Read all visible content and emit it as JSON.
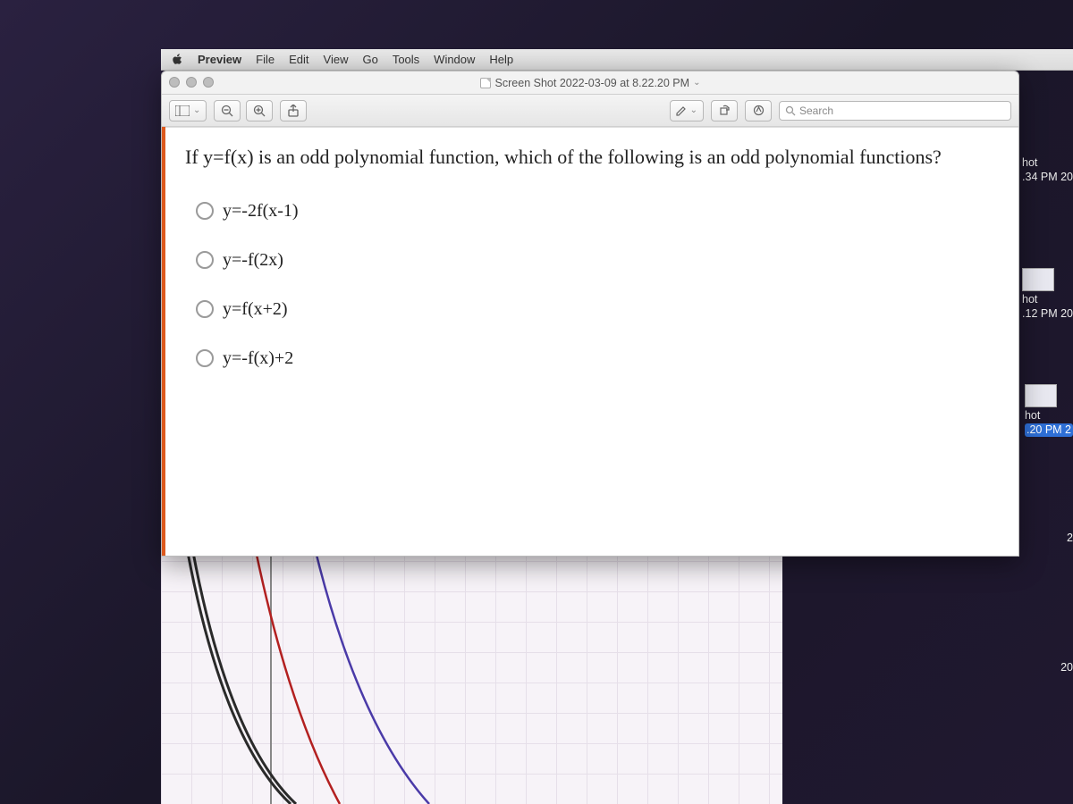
{
  "menubar": {
    "app": "Preview",
    "items": [
      "File",
      "Edit",
      "View",
      "Go",
      "Tools",
      "Window",
      "Help"
    ]
  },
  "window": {
    "title": "Screen Shot 2022-03-09 at 8.22.20 PM",
    "search_placeholder": "Search"
  },
  "question": "If y=f(x) is an odd polynomial function, which of the following is an odd polynomial functions?",
  "options": [
    "y=-2f(x-1)",
    "y=-f(2x)",
    "y=f(x+2)",
    "y=-f(x)+2"
  ],
  "desktop_labels": [
    {
      "l1": "hot",
      "l2": ".34 PM  20"
    },
    {
      "l1": "hot",
      "l2": ".12 PM  20"
    },
    {
      "l1": "hot",
      "l2": ".20 PM  2",
      "selected": true
    }
  ],
  "desktop_extra": [
    "2",
    "20"
  ]
}
